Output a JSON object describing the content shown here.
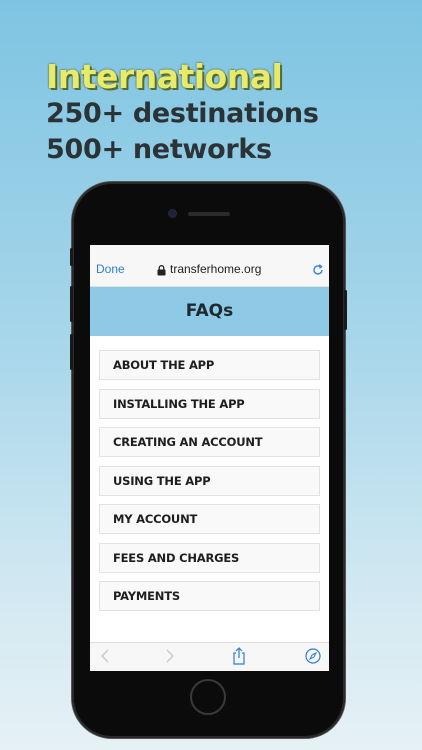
{
  "headline": {
    "line1": "International",
    "line2": "250+ destinations",
    "line3": "500+ networks"
  },
  "browser": {
    "done_label": "Done",
    "url": "transferhome.org"
  },
  "page": {
    "title": "FAQs",
    "items": [
      {
        "label": "ABOUT THE APP"
      },
      {
        "label": "INSTALLING THE APP"
      },
      {
        "label": "CREATING AN ACCOUNT"
      },
      {
        "label": "USING THE APP"
      },
      {
        "label": "MY ACCOUNT"
      },
      {
        "label": "FEES AND CHARGES"
      },
      {
        "label": "PAYMENTS"
      }
    ]
  },
  "toolbar": {
    "icons": [
      "back-icon",
      "forward-icon",
      "share-icon",
      "compass-icon"
    ]
  },
  "colors": {
    "accent": "#2c7fd6",
    "header_bg": "#8ec9e6",
    "headline_yellow": "#e8ea6a"
  }
}
